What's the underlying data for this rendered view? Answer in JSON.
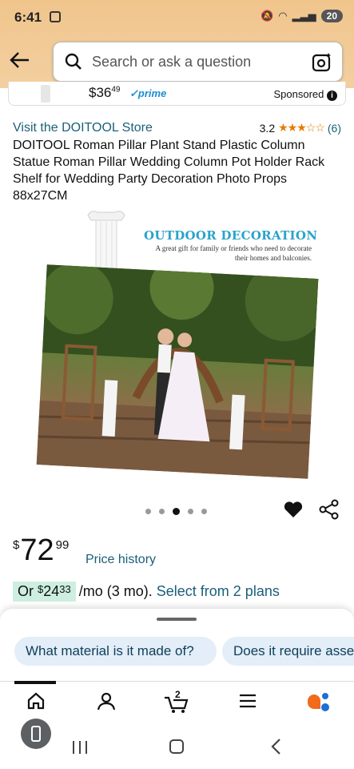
{
  "status_bar": {
    "time": "6:41",
    "battery": "20"
  },
  "search": {
    "placeholder": "Search or ask a question"
  },
  "sponsored": {
    "price_whole": "$36",
    "price_cents": "49",
    "prime": "✓prime",
    "label": "Sponsored"
  },
  "product": {
    "store_link": "Visit the DOITOOL Store",
    "rating": "3.2",
    "stars": "★★★☆☆",
    "rating_count": "(6)",
    "title": "DOITOOL Roman Pillar Plant Stand Plastic Column Statue Roman Pillar Wedding Column Pot Holder Rack Shelf for Wedding Party Decoration Photo Props 88x27CM",
    "image_headline": "OUTDOOR DECORATION",
    "image_subline": "A great gift for family or friends who need to decorate their homes and balconies.",
    "image_count": 5,
    "active_image": 3
  },
  "price": {
    "currency": "$",
    "whole": "72",
    "cents": "99",
    "history_link": "Price history"
  },
  "installment": {
    "prefix": "Or ",
    "currency": "$",
    "whole": "24",
    "cents": "33",
    "term": "/mo (3 mo).",
    "link": "Select from 2 plans"
  },
  "questions": [
    "What material is it made of?",
    "Does it require asse"
  ],
  "nav": {
    "cart_count": "2"
  },
  "colors": {
    "header": "#f0c58c",
    "link": "#1a5f7a",
    "star": "#e67a00",
    "chip": "#e3eef8",
    "installment_highlight": "#cdeee0"
  }
}
